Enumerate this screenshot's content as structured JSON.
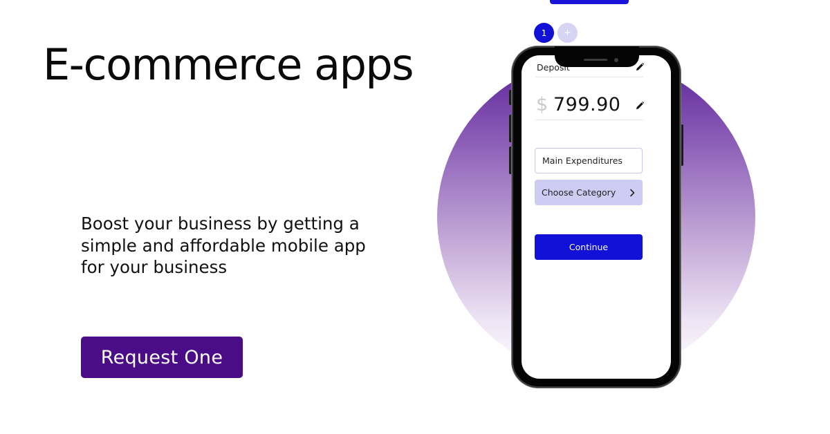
{
  "hero": {
    "title": "E-commerce apps",
    "subtitle": "Boost your business by getting a simple and affordable mobile app for your business",
    "cta_label": "Request One"
  },
  "stepper": {
    "steps": [
      {
        "label": "1",
        "active": true
      },
      {
        "label": "+",
        "active": false
      }
    ]
  },
  "phone_screen": {
    "deposit_label": "Deposit",
    "currency_symbol": "$",
    "amount": "799.90",
    "expenditures_field": "Main Expenditures",
    "category_label": "Choose Category",
    "continue_label": "Continue"
  },
  "colors": {
    "brand_purple": "#4b0c88",
    "accent_blue": "#1010d6",
    "soft_lavender": "#cfccf4",
    "circle_top": "#5b2297"
  },
  "icons": {
    "edit": "pencil-icon",
    "chevron": "chevron-right-icon"
  }
}
